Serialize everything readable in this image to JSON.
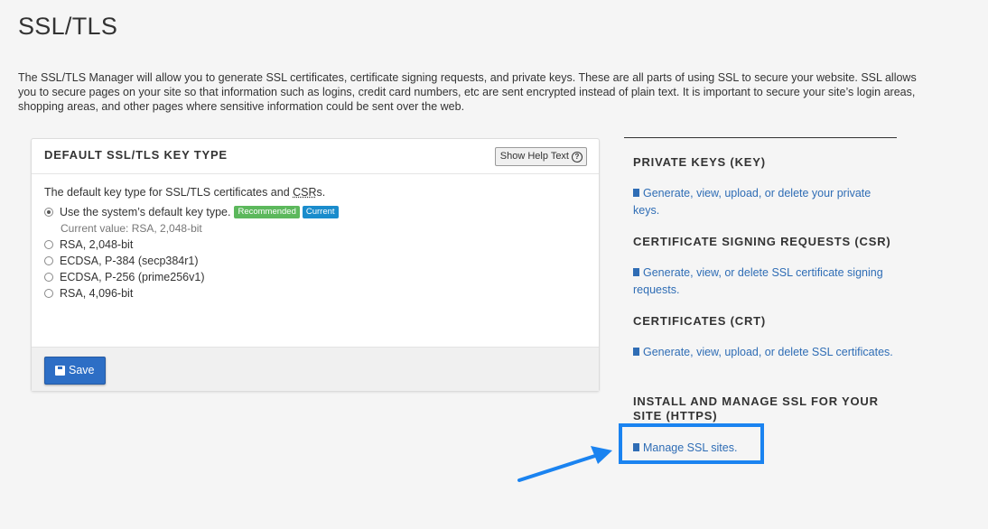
{
  "page": {
    "title": "SSL/TLS",
    "intro": "The SSL/TLS Manager will allow you to generate SSL certificates, certificate signing requests, and private keys. These are all parts of using SSL to secure your website. SSL allows you to secure pages on your site so that information such as logins, credit card numbers, etc are sent encrypted instead of plain text. It is important to secure your site’s login areas, shopping areas, and other pages where sensitive information could be sent over the web."
  },
  "panel": {
    "title": "DEFAULT SSL/TLS KEY TYPE",
    "help_button": "Show Help Text",
    "description_prefix": "The default key type for SSL/TLS certificates and ",
    "description_abbr": "CSR",
    "description_suffix": "s.",
    "options": [
      {
        "label": "Use the system’s default key type.",
        "checked": true
      },
      {
        "label": "RSA, 2,048-bit",
        "checked": false
      },
      {
        "label": "ECDSA, P-384 (secp384r1)",
        "checked": false
      },
      {
        "label": "ECDSA, P-256 (prime256v1)",
        "checked": false
      },
      {
        "label": "RSA, 4,096-bit",
        "checked": false
      }
    ],
    "badge_recommended": "Recommended",
    "badge_current": "Current",
    "current_value": "Current value: RSA, 2,048-bit",
    "save_label": "Save"
  },
  "sidebar": {
    "sections": [
      {
        "heading": "PRIVATE KEYS (KEY)",
        "link": "Generate, view, upload, or delete your private keys."
      },
      {
        "heading": "CERTIFICATE SIGNING REQUESTS (CSR)",
        "link": "Generate, view, or delete SSL certificate signing requests."
      },
      {
        "heading": "CERTIFICATES (CRT)",
        "link": "Generate, view, upload, or delete SSL certificates."
      },
      {
        "heading": "INSTALL AND MANAGE SSL FOR YOUR SITE (HTTPS)",
        "link": "Manage SSL sites."
      }
    ]
  },
  "colors": {
    "link": "#2f6db5",
    "primary_button": "#2d6ec5",
    "badge_recommended": "#5cb85c",
    "badge_current": "#1a8ccc",
    "highlight": "#1a83f0"
  },
  "icons": {
    "save": "floppy-disk-icon",
    "help": "question-circle-icon",
    "link": "file-icon"
  }
}
